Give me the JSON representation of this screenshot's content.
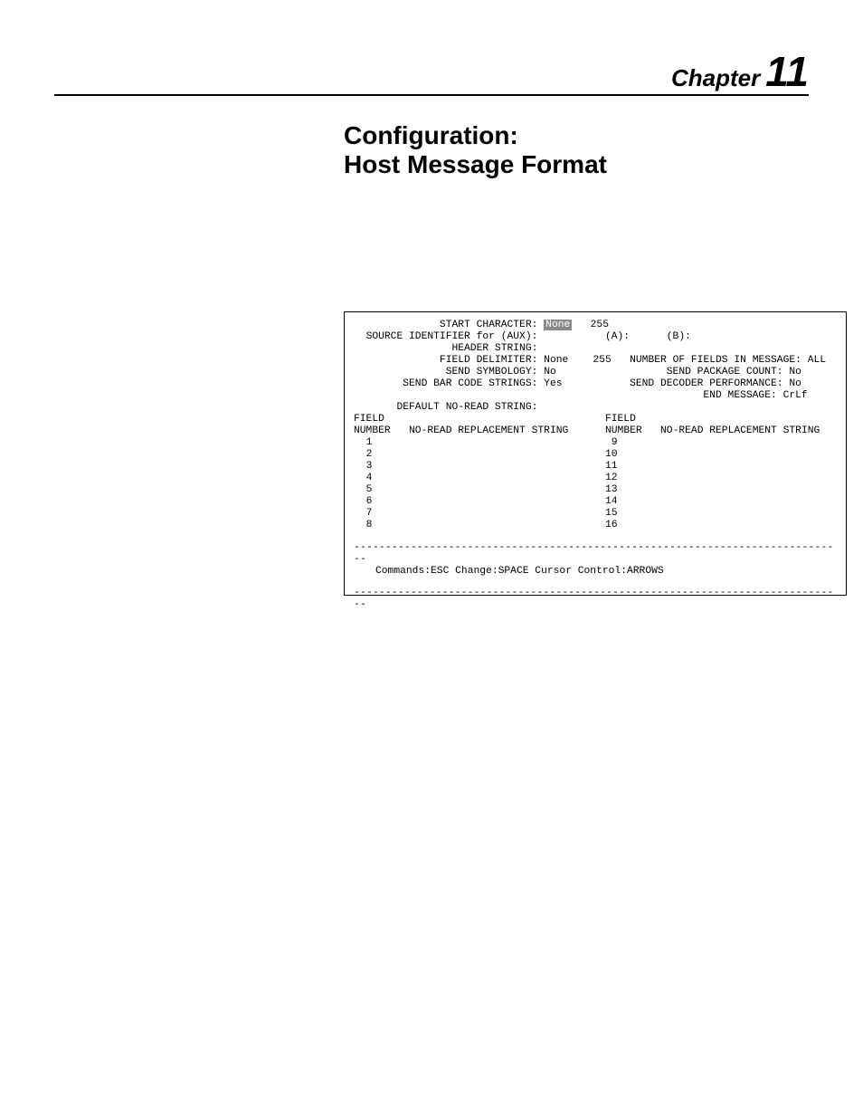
{
  "chapter": {
    "label": "Chapter",
    "number": "11"
  },
  "title": {
    "line1": "Configuration:",
    "line2": "Host Message Format"
  },
  "config": {
    "start_character_label": "START CHARACTER:",
    "start_character_value": "None",
    "start_character_code": "255",
    "source_identifier_label": "SOURCE IDENTIFIER for (AUX):",
    "source_identifier_a_label": "(A):",
    "source_identifier_b_label": "(B):",
    "header_string_label": "HEADER STRING:",
    "field_delimiter_label": "FIELD DELIMITER:",
    "field_delimiter_value": "None",
    "field_delimiter_code": "255",
    "number_of_fields_label": "NUMBER OF FIELDS IN MESSAGE:",
    "number_of_fields_value": "ALL",
    "send_symbology_label": "SEND SYMBOLOGY:",
    "send_symbology_value": "No",
    "send_package_count_label": "SEND PACKAGE COUNT:",
    "send_package_count_value": "No",
    "send_bar_code_label": "SEND BAR CODE STRINGS:",
    "send_bar_code_value": "Yes",
    "send_decoder_perf_label": "SEND DECODER PERFORMANCE:",
    "send_decoder_perf_value": "No",
    "end_message_label": "END MESSAGE:",
    "end_message_value": "CrLf",
    "default_noread_label": "DEFAULT NO-READ STRING:",
    "table_header_field": "FIELD",
    "table_header_number": "NUMBER",
    "table_header_noread": "NO-READ REPLACEMENT STRING",
    "left_numbers": [
      "1",
      "2",
      "3",
      "4",
      "5",
      "6",
      "7",
      "8"
    ],
    "right_numbers": [
      "9",
      "10",
      "11",
      "12",
      "13",
      "14",
      "15",
      "16"
    ]
  },
  "commands": {
    "main_label": "Commands:",
    "main_value": "ESC",
    "change_label": "Change:",
    "change_value": "SPACE",
    "cursor_label": "Cursor Control:",
    "cursor_value": "ARROWS"
  },
  "rule": "------------------------------------------------------------------------------"
}
